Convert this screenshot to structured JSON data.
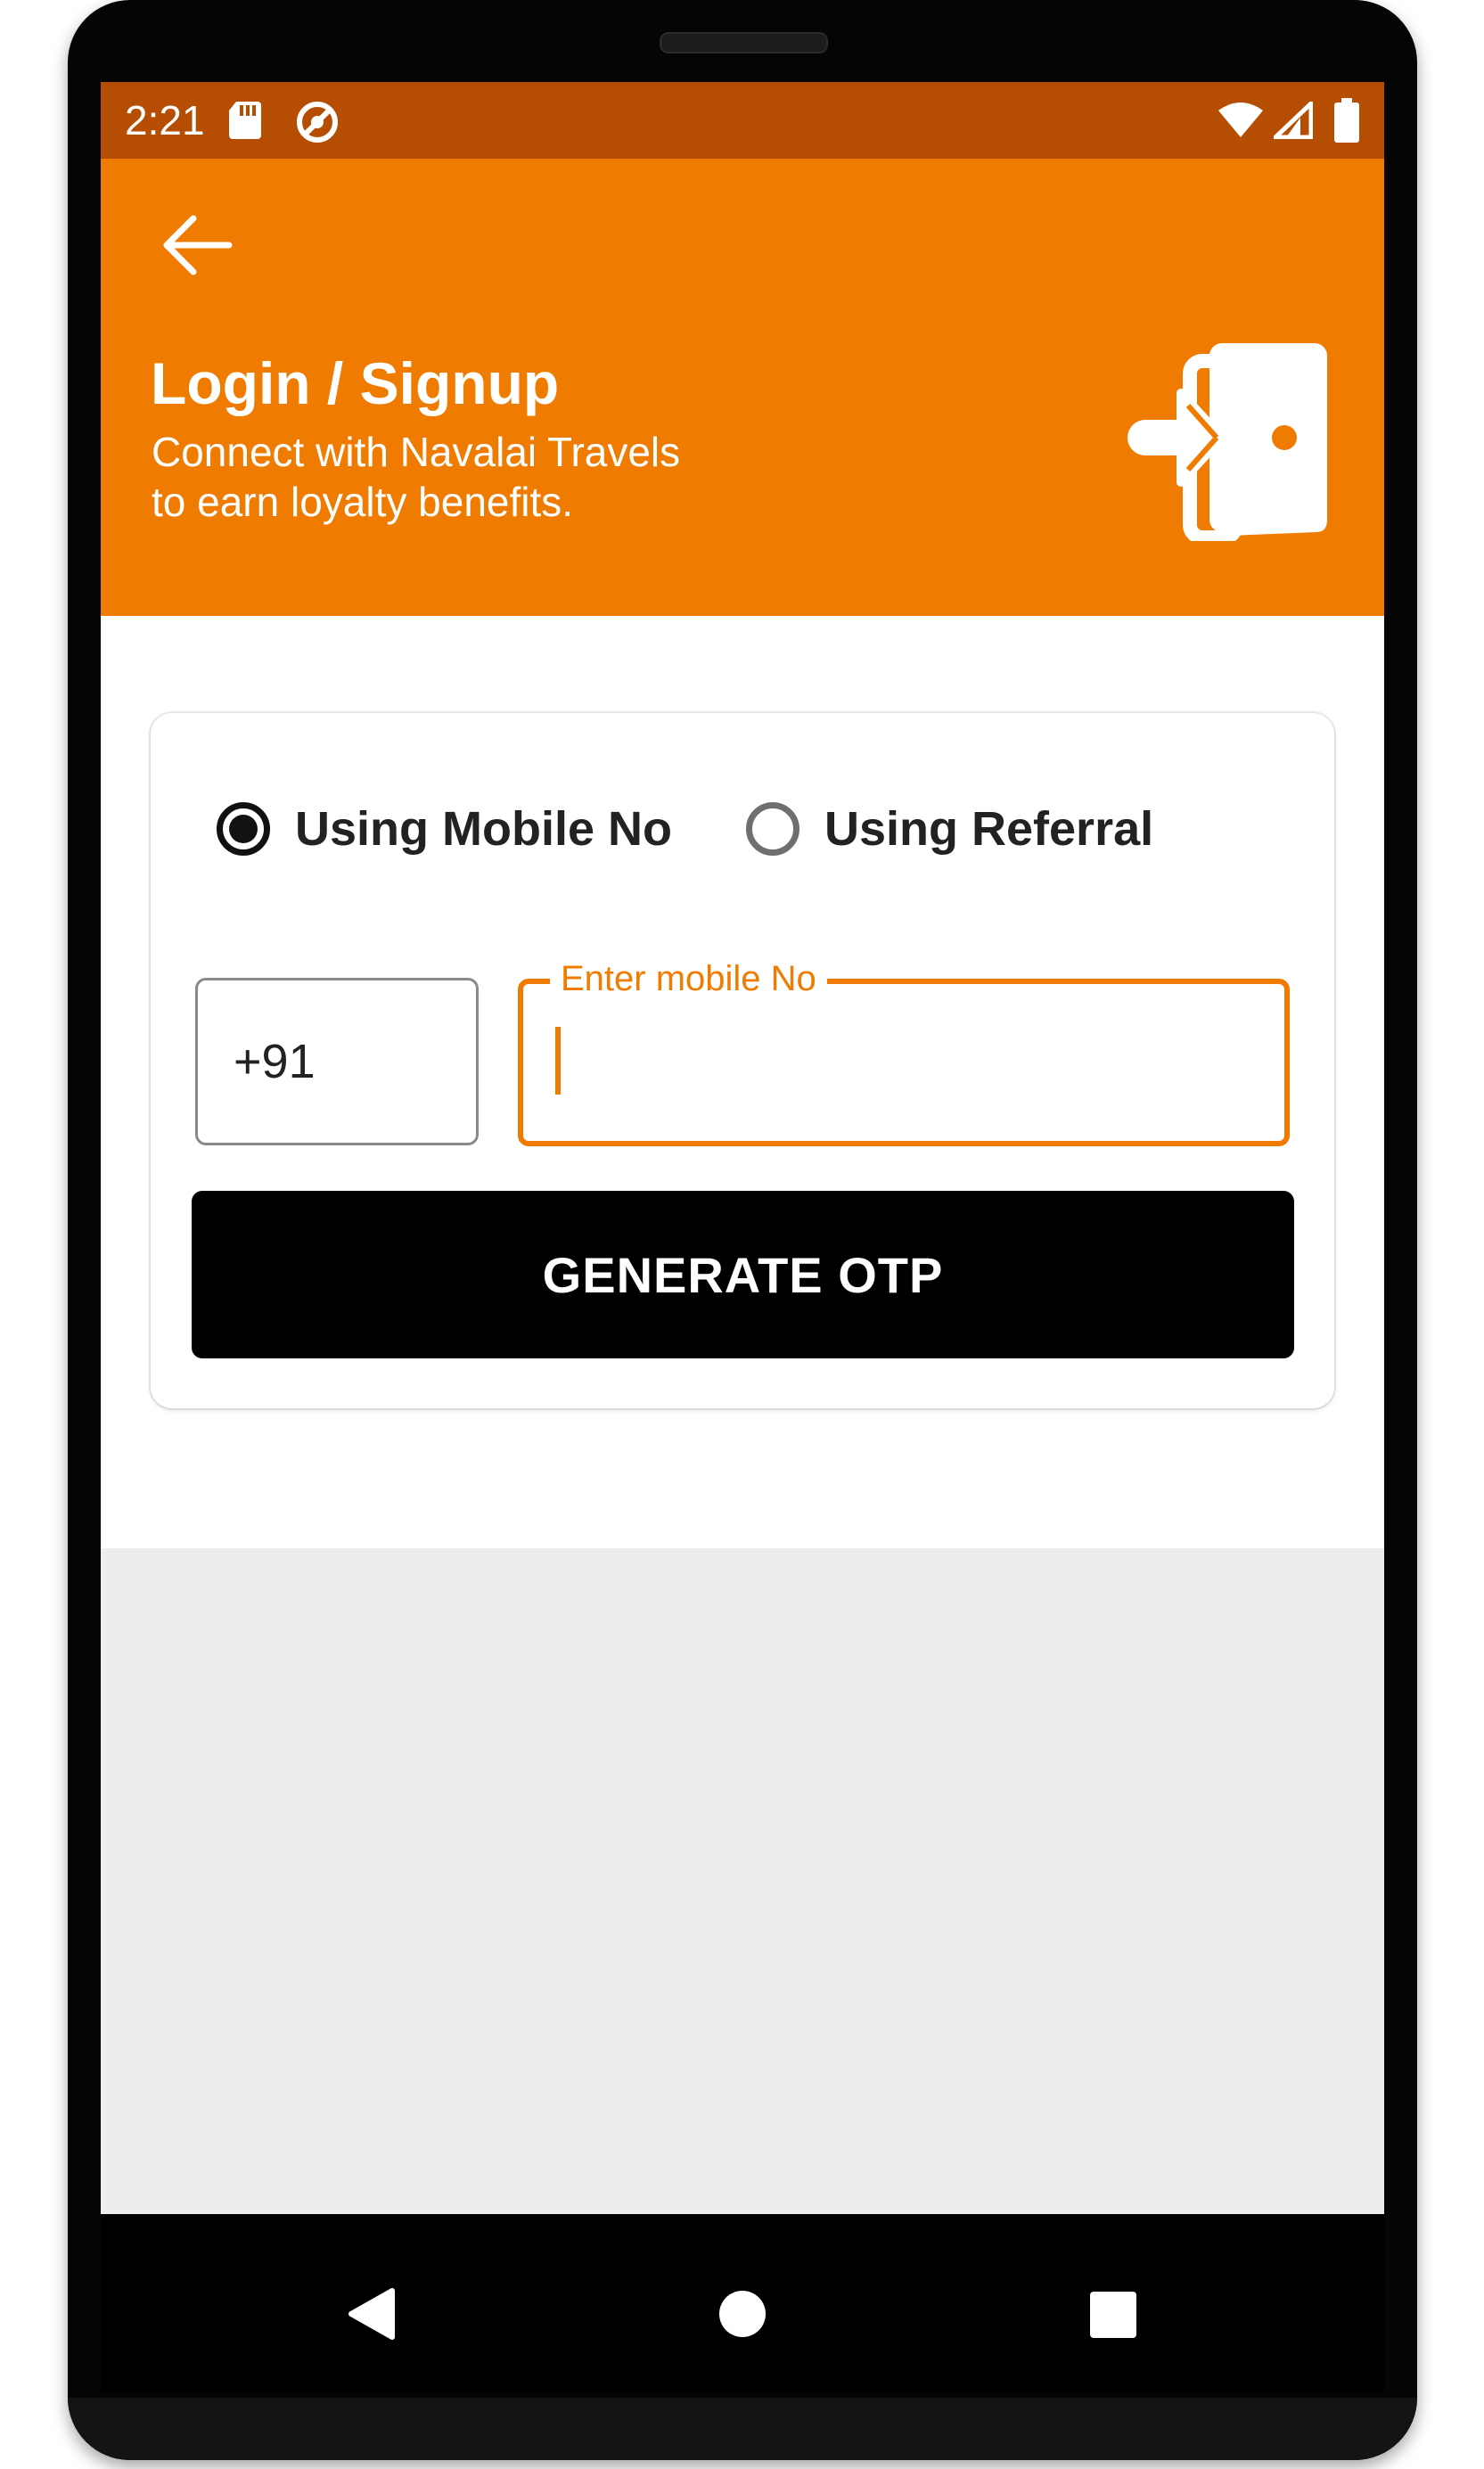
{
  "status_bar": {
    "time": "2:21",
    "left_icons": [
      "sd-card-icon",
      "do-not-disturb-icon"
    ],
    "right_icons": [
      "wifi-icon",
      "signal-icon",
      "battery-icon"
    ],
    "background": "#b54d02"
  },
  "header": {
    "title": "Login / Signup",
    "subtitle_line1": "Connect with Navalai Travels",
    "subtitle_line2": "to earn loyalty benefits.",
    "background": "#ef7c00",
    "back_icon": "arrow-left-icon",
    "illustration_icon": "login-door-icon"
  },
  "login_form": {
    "options": [
      {
        "label": "Using Mobile No",
        "selected": true
      },
      {
        "label": "Using Referral",
        "selected": false
      }
    ],
    "country_code": "+91",
    "mobile_label": "Enter mobile No",
    "mobile_value": "",
    "generate_button": "GENERATE OTP",
    "accent": "#ef7c00"
  },
  "nav_bar": {
    "icons": [
      "back-triangle-icon",
      "home-circle-icon",
      "recents-square-icon"
    ]
  }
}
